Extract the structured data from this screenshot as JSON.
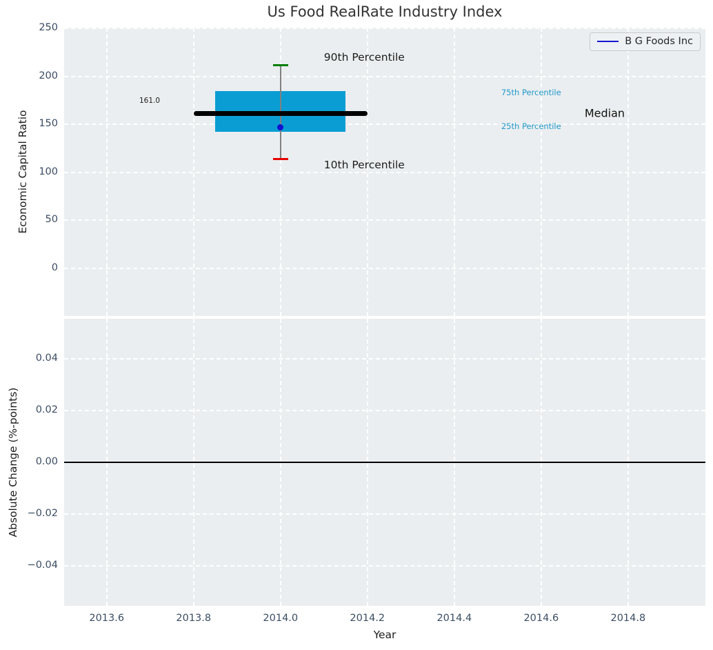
{
  "figure": {
    "title": "Us Food RealRate Industry Index",
    "plot_background": "#ebeef0",
    "grid_color": "#ffffff",
    "tick_color": "#3b4c63",
    "text_color": "#1c1c1c"
  },
  "chart_data": [
    {
      "type": "boxplot",
      "title": "Us Food RealRate Industry Index",
      "ylabel": "Economic Capital Ratio",
      "xlim": [
        2013.502,
        2014.978
      ],
      "ylim": [
        -50,
        251
      ],
      "grid": true,
      "x_tick_labels_visible": false,
      "xticks": [
        {
          "value": 2013.6,
          "label": "2013.6"
        },
        {
          "value": 2013.8,
          "label": "2013.8"
        },
        {
          "value": 2014.0,
          "label": "2014.0"
        },
        {
          "value": 2014.2,
          "label": "2014.2"
        },
        {
          "value": 2014.4,
          "label": "2014.4"
        },
        {
          "value": 2014.6,
          "label": "2014.6"
        },
        {
          "value": 2014.8,
          "label": "2014.8"
        }
      ],
      "yticks": [
        {
          "value": 250,
          "label": "250"
        },
        {
          "value": 200,
          "label": "200"
        },
        {
          "value": 150,
          "label": "150"
        },
        {
          "value": 100,
          "label": "100"
        },
        {
          "value": 50,
          "label": "50"
        },
        {
          "value": 0,
          "label": "0"
        }
      ],
      "legend": {
        "label": "B G Foods Inc",
        "color": "#1616d2",
        "location": "upper right"
      },
      "box": {
        "x_center": 2014.0,
        "percentile_90": 212,
        "percentile_75": 185,
        "median": 161,
        "percentile_25": 142,
        "percentile_10": 114,
        "company_value": 147,
        "median_value_label": "161.0",
        "box_x_span": [
          2013.85,
          2014.15
        ],
        "median_x_span": [
          2013.8,
          2014.2
        ],
        "colors": {
          "box_fill": "#0a9dd3",
          "median_line": "#000000",
          "cap_90": "#007d02",
          "cap_10": "#e60000",
          "whisker": "#808080",
          "company_marker": "#1212d0"
        }
      },
      "annotations": [
        {
          "text": "90th Percentile",
          "x": 2014.1,
          "y": 220,
          "color": "#1c1c1c",
          "font_size": 15.5,
          "name": "annotation-90th-percentile"
        },
        {
          "text": "10th Percentile",
          "x": 2014.1,
          "y": 108,
          "color": "#1c1c1c",
          "font_size": 15.5,
          "name": "annotation-10th-percentile"
        },
        {
          "text": "161.0",
          "x": 2013.675,
          "y": 175,
          "color": "#1c1c1c",
          "font_size": 10.5,
          "name": "annotation-median-value"
        },
        {
          "text": "75th Percentile",
          "x": 2014.508,
          "y": 183,
          "color": "#2199cb",
          "font_size": 11.5,
          "name": "annotation-75th-percentile"
        },
        {
          "text": "25th Percentile",
          "x": 2014.508,
          "y": 148,
          "color": "#2199cb",
          "font_size": 11.5,
          "name": "annotation-25th-percentile"
        },
        {
          "text": "Median",
          "x": 2014.7,
          "y": 162,
          "color": "#111111",
          "font_size": 16,
          "name": "annotation-median"
        }
      ]
    },
    {
      "type": "line",
      "ylabel": "Absolute Change (%-points)",
      "xlabel": "Year",
      "xlim": [
        2013.502,
        2014.978
      ],
      "ylim": [
        -0.0553,
        0.0553
      ],
      "grid": true,
      "x_tick_labels_visible": true,
      "xticks": [
        {
          "value": 2013.6,
          "label": "2013.6"
        },
        {
          "value": 2013.8,
          "label": "2013.8"
        },
        {
          "value": 2014.0,
          "label": "2014.0"
        },
        {
          "value": 2014.2,
          "label": "2014.2"
        },
        {
          "value": 2014.4,
          "label": "2014.4"
        },
        {
          "value": 2014.6,
          "label": "2014.6"
        },
        {
          "value": 2014.8,
          "label": "2014.8"
        }
      ],
      "yticks": [
        {
          "value": 0.04,
          "label": "0.04"
        },
        {
          "value": 0.02,
          "label": "0.02"
        },
        {
          "value": 0.0,
          "label": "0.00"
        },
        {
          "value": -0.02,
          "label": "−0.02"
        },
        {
          "value": -0.04,
          "label": "−0.04"
        }
      ],
      "zero_line": {
        "value": 0,
        "color": "#000000"
      },
      "series": []
    }
  ]
}
